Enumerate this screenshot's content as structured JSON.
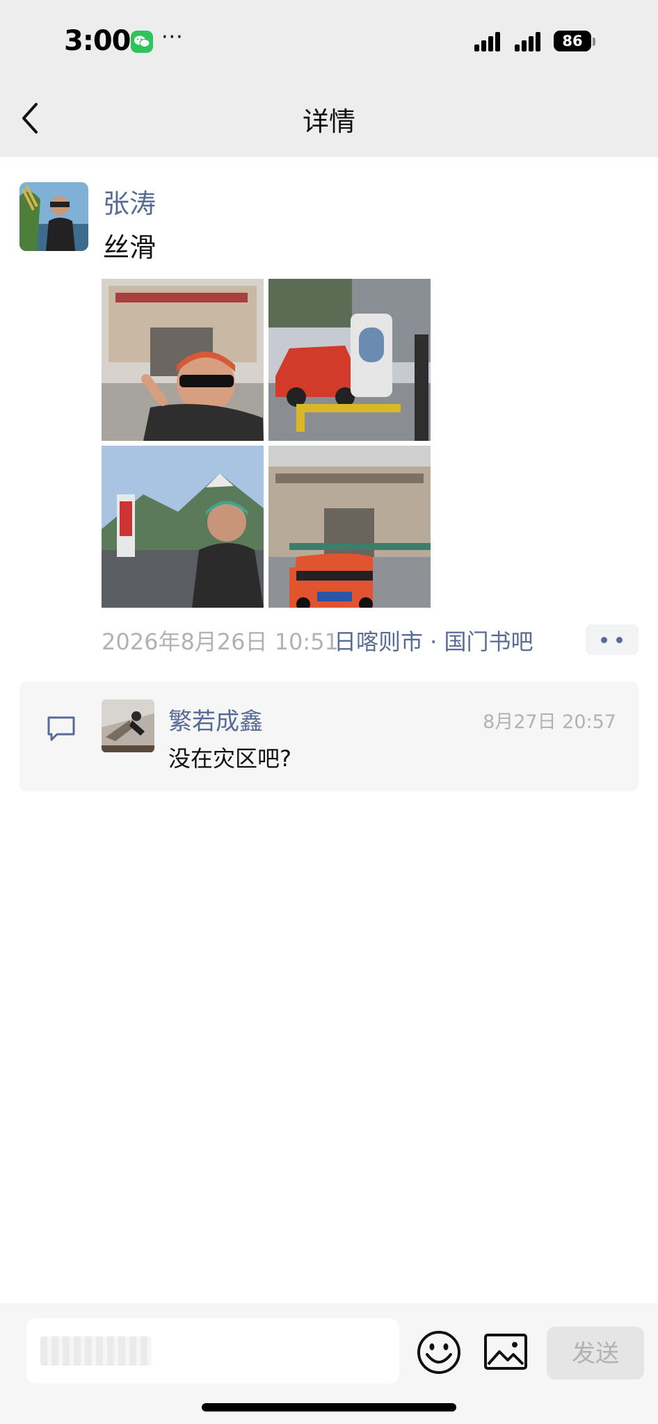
{
  "status_bar": {
    "time": "3:00",
    "more": "···",
    "battery": "86",
    "icons": [
      "wechat-icon",
      "signal-icon",
      "battery-icon"
    ]
  },
  "nav": {
    "title": "详情",
    "back_icon": "chevron-left-icon"
  },
  "post": {
    "author": "张涛",
    "text": "丝滑",
    "photos": [
      {
        "icon": "photo-selfie-icon",
        "description_color": "#c9b9a4"
      },
      {
        "icon": "photo-car-gas-station-icon",
        "description_color": "#d23a2a"
      },
      {
        "icon": "photo-mountain-icon",
        "description_color": "#6e8bb3"
      },
      {
        "icon": "photo-car-building-icon",
        "description_color": "#e0552f"
      }
    ],
    "timestamp": "2026年8月26日 10:51",
    "location": "日喀则市 · 国门书吧",
    "more_icon": "more-dots-icon"
  },
  "comments": [
    {
      "name": "繁若成鑫",
      "time": "8月27日 20:57",
      "text": "没在灾区吧?"
    }
  ],
  "input_bar": {
    "placeholder": "",
    "send_label": "发送",
    "icons": [
      "emoji-icon",
      "image-icon"
    ]
  },
  "colors": {
    "link": "#576b95",
    "nav_bg": "#ededed",
    "wechat_green": "#2fc35a",
    "muted": "#b2b2b2"
  }
}
